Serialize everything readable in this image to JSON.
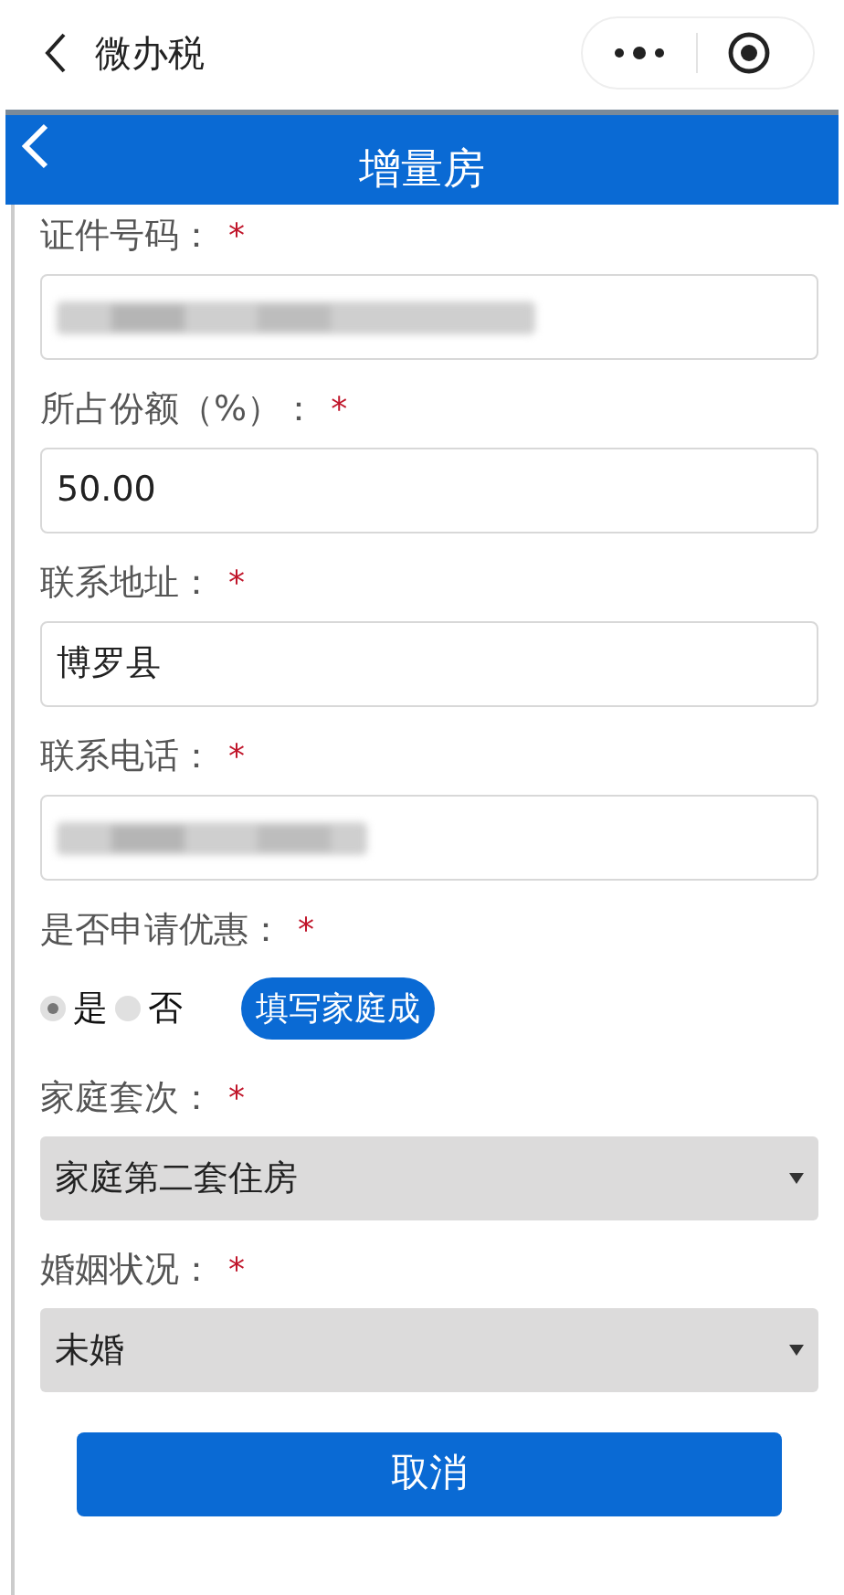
{
  "top_bar": {
    "title": "微办税"
  },
  "header": {
    "title": "增量房"
  },
  "fields": [
    {
      "kind": "blurred",
      "label": "证件号码：",
      "required_mark": "*"
    },
    {
      "kind": "text",
      "label": "所占份额（%）：",
      "required_mark": "*",
      "value": "50.00"
    },
    {
      "kind": "text",
      "label": "联系地址：",
      "required_mark": "*",
      "value": "博罗县"
    },
    {
      "kind": "blurred",
      "label": "联系电话：",
      "required_mark": "*"
    },
    {
      "kind": "radio",
      "label": "是否申请优惠：",
      "required_mark": "*",
      "options": [
        {
          "label": "是",
          "selected": true
        },
        {
          "label": "否",
          "selected": false
        }
      ],
      "action": "填写家庭成"
    },
    {
      "kind": "select",
      "label": "家庭套次：",
      "required_mark": "*",
      "value": "家庭第二套住房"
    },
    {
      "kind": "select",
      "label": "婚姻状况：",
      "required_mark": "*",
      "value": "未婚"
    }
  ],
  "button": "取消"
}
